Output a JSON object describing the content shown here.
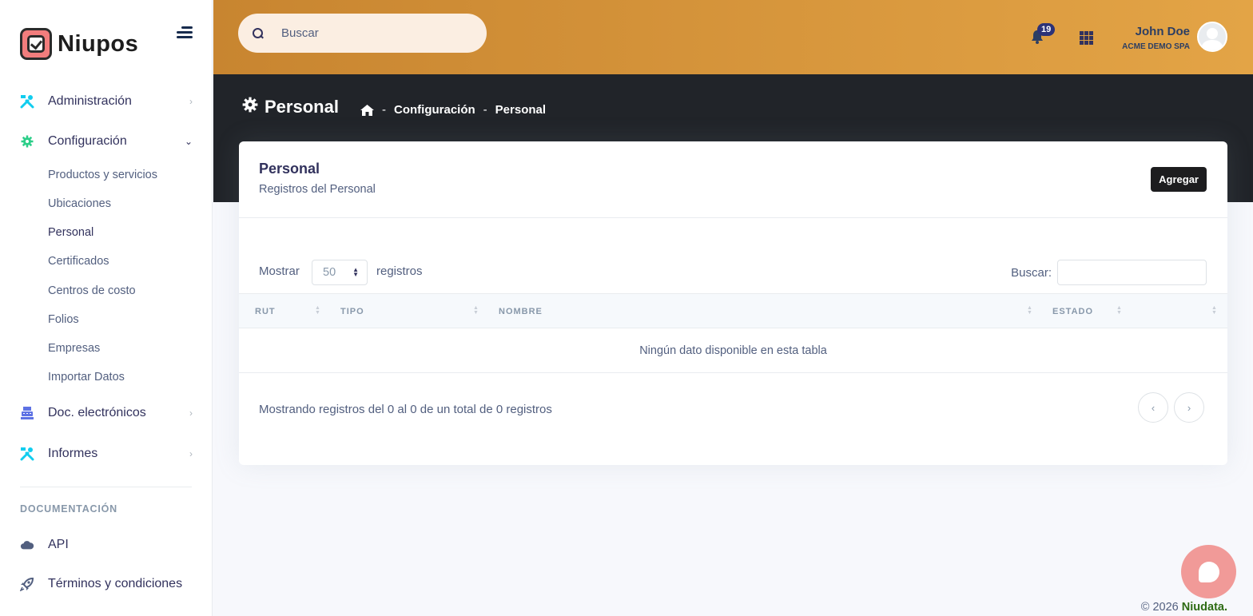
{
  "brand": {
    "name": "Niupos"
  },
  "sidebar": {
    "items": [
      {
        "label": "Administración",
        "icon": "tools-icon"
      },
      {
        "label": "Configuración",
        "icon": "gear-icon"
      },
      {
        "label": "Doc. electrónicos",
        "icon": "cash-register-icon"
      },
      {
        "label": "Informes",
        "icon": "tools-icon"
      }
    ],
    "sub_items": [
      "Productos y servicios",
      "Ubicaciones",
      "Personal",
      "Certificados",
      "Centros de costo",
      "Folios",
      "Empresas",
      "Importar Datos"
    ],
    "active_sub_item": "Personal",
    "doc_heading": "DOCUMENTACIÓN",
    "doc_items": [
      {
        "label": "API",
        "icon": "cloud-icon"
      },
      {
        "label": "Términos y condiciones",
        "icon": "rocket-icon"
      }
    ]
  },
  "header": {
    "search_placeholder": "Buscar",
    "notifications_count": "19",
    "user_name": "John Doe",
    "user_company": "ACME DEMO SPA"
  },
  "page": {
    "title": "Personal",
    "breadcrumb": [
      "Configuración",
      "Personal"
    ]
  },
  "card": {
    "title": "Personal",
    "subtitle": "Registros del Personal",
    "add_button": "Agregar",
    "show_label": "Mostrar",
    "page_size": "50",
    "records_label": "registros",
    "search_label": "Buscar:",
    "columns": [
      "RUT",
      "TIPO",
      "NOMBRE",
      "ESTADO",
      ""
    ],
    "empty_message": "Ningún dato disponible en esta tabla",
    "info": "Mostrando registros del 0 al 0 de un total de 0 registros"
  },
  "footer": {
    "copyright": "© 2026",
    "brand": "Niudata."
  },
  "colors": {
    "accent": "#e3a446",
    "dark": "#212429",
    "brand_red": "#f27d7d",
    "footer_brand": "#2e6b14"
  }
}
